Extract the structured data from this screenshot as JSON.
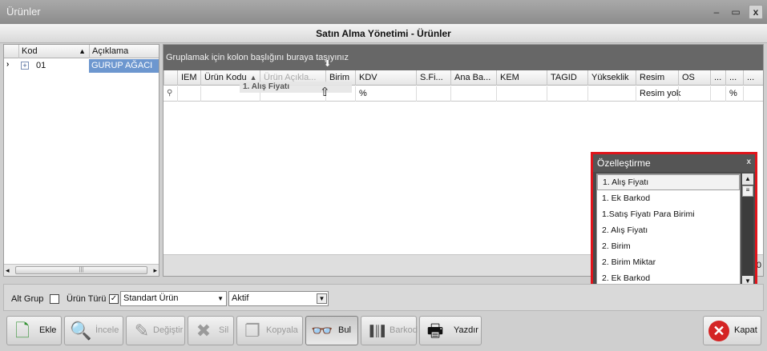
{
  "window": {
    "title": "Ürünler",
    "min": "‒",
    "max": "▭",
    "close": "x"
  },
  "header": {
    "title": "Satın Alma Yönetimi - Ürünler"
  },
  "tree": {
    "col_kod": "Kod",
    "col_aciklama": "Açıklama",
    "sort": "▲",
    "row": {
      "indicator": "›",
      "expand": "+",
      "kod": "01",
      "aciklama": "GURUP AĞACI"
    },
    "scroll": {
      "left": "◂",
      "right": "▸",
      "grip": "|||"
    }
  },
  "grid": {
    "group_hint": "Gruplamak için kolon başlığını buraya taşıyınız",
    "drag_down_arrow": "⬇",
    "drag_up_arrow": "⇧",
    "dragging_column": "1. Alış Fiyatı",
    "columns": [
      "IEM",
      "Ürün Kodu",
      "Ürün Açıkla...",
      "Birim",
      "KDV",
      "S.Fi...",
      "Ana Ba...",
      "KEM",
      "TAGID",
      "Yükseklik",
      "Resim",
      "OS",
      "...",
      "...",
      "..."
    ],
    "sort_indicator": "▲",
    "filter": {
      "icon": "⚲",
      "kdv": "%",
      "resim": "Resim yok",
      "extra": "%"
    },
    "footer_count": "0"
  },
  "customize": {
    "title": "Özelleştirme",
    "close": "x",
    "items": [
      "1. Alış Fiyatı",
      "1. Ek Barkod",
      "1.Satış Fiyatı Para Birimi",
      "2. Alış Fiyatı",
      "2. Birim",
      "2. Birim Miktar",
      "2. Ek Barkod"
    ],
    "scroll_up": "▲",
    "scroll_thumb": "≡",
    "scroll_down": "▼"
  },
  "filterbar": {
    "alt_grup": "Alt Grup",
    "urun_turu": "Ürün Türü",
    "urun_turu_checked": "✓",
    "urun_turu_value": "Standart Ürün",
    "status_value": "Aktif",
    "dropdown_arrow": "▼"
  },
  "toolbar": {
    "ekle": "Ekle",
    "incele": "İncele",
    "degistir": "Değiştir",
    "sil": "Sil",
    "kopyala": "Kopyala",
    "bul": "Bul",
    "barkod": "Barkod",
    "yazdir": "Yazdır",
    "kapat": "Kapat",
    "icons": {
      "ekle": "🗋",
      "incele": "🔍",
      "degistir": "✎",
      "sil": "✖",
      "kopyala": "❐",
      "bul": "👓",
      "barkod": "▐║▌",
      "yazdir": "🖶",
      "kapat": "✕"
    }
  }
}
